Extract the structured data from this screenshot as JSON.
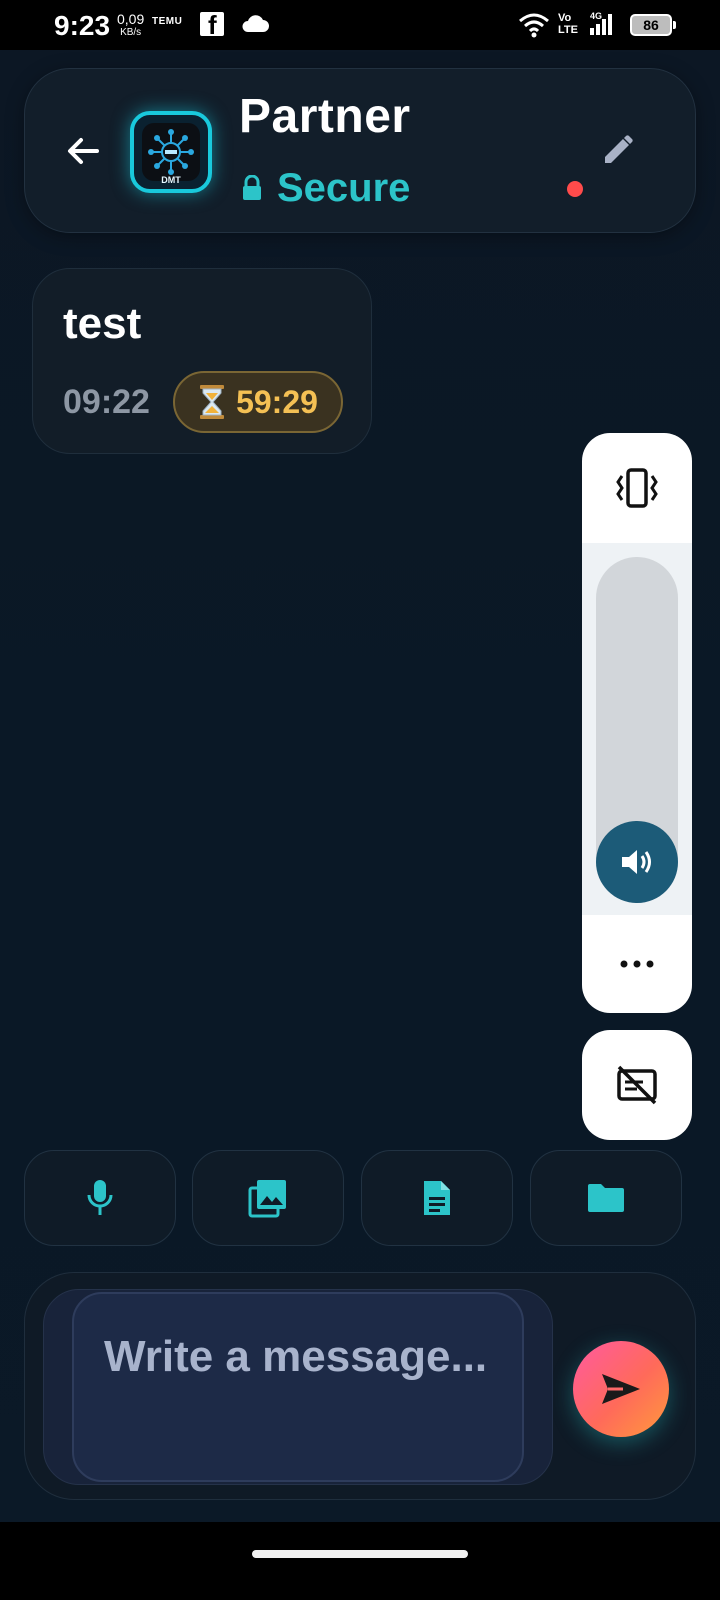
{
  "status_bar": {
    "time": "9:23",
    "net_speed": "0,09",
    "net_unit": "KB/s",
    "temu_label": "TEMU",
    "volte_top": "Vo",
    "volte_bottom": "LTE",
    "network": "4G",
    "battery": "86"
  },
  "header": {
    "contact_name": "Partner",
    "security_label": "Secure",
    "avatar_text": "DMT",
    "status_color": "#ff4b4b"
  },
  "messages": [
    {
      "text": "test",
      "time": "09:22",
      "timer": "59:29",
      "timer_icon": "hourglass-icon"
    }
  ],
  "volume_panel": {
    "level": 0.0,
    "icons": [
      "vibrate-icon",
      "speaker-icon",
      "more-icon",
      "captions-off-icon"
    ]
  },
  "attachments": [
    "mic-icon",
    "image-icon",
    "document-icon",
    "folder-icon"
  ],
  "composer": {
    "placeholder": "Write a message..."
  },
  "colors": {
    "accent": "#2cc4c9",
    "timer": "#f4c054",
    "background": "#0c1724"
  }
}
